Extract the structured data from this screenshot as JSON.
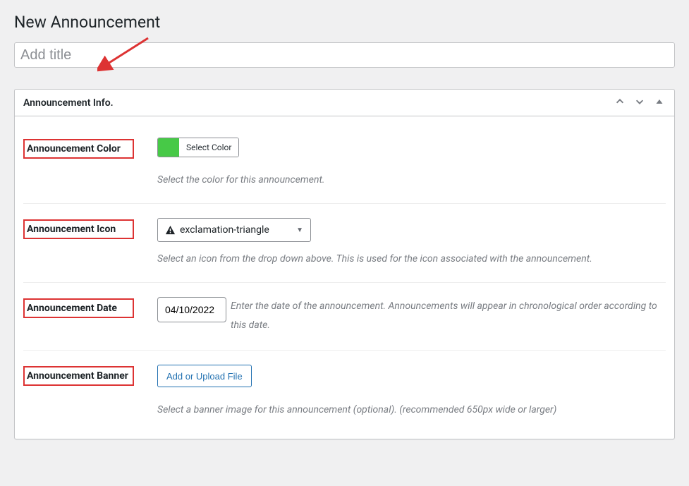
{
  "page": {
    "title": "New Announcement"
  },
  "title_field": {
    "placeholder": "Add title"
  },
  "panel": {
    "heading": "Announcement Info.",
    "controls": {
      "up": "chevron-up",
      "down": "chevron-down",
      "toggle": "collapse"
    }
  },
  "fields": {
    "color": {
      "label": "Announcement Color",
      "swatch_hex": "#47c947",
      "button": "Select Color",
      "desc": "Select the color for this announcement."
    },
    "icon": {
      "label": "Announcement Icon",
      "selected": "exclamation-triangle",
      "desc": "Select an icon from the drop down above. This is used for the icon associated with the announcement."
    },
    "date": {
      "label": "Announcement Date",
      "value": "04/10/2022",
      "desc": "Enter the date of the announcement. Announcements will appear in chronological order according to this date."
    },
    "banner": {
      "label": "Announcement Banner",
      "button": "Add or Upload File",
      "desc": "Select a banner image for this announcement (optional). (recommended 650px wide or larger)"
    }
  }
}
